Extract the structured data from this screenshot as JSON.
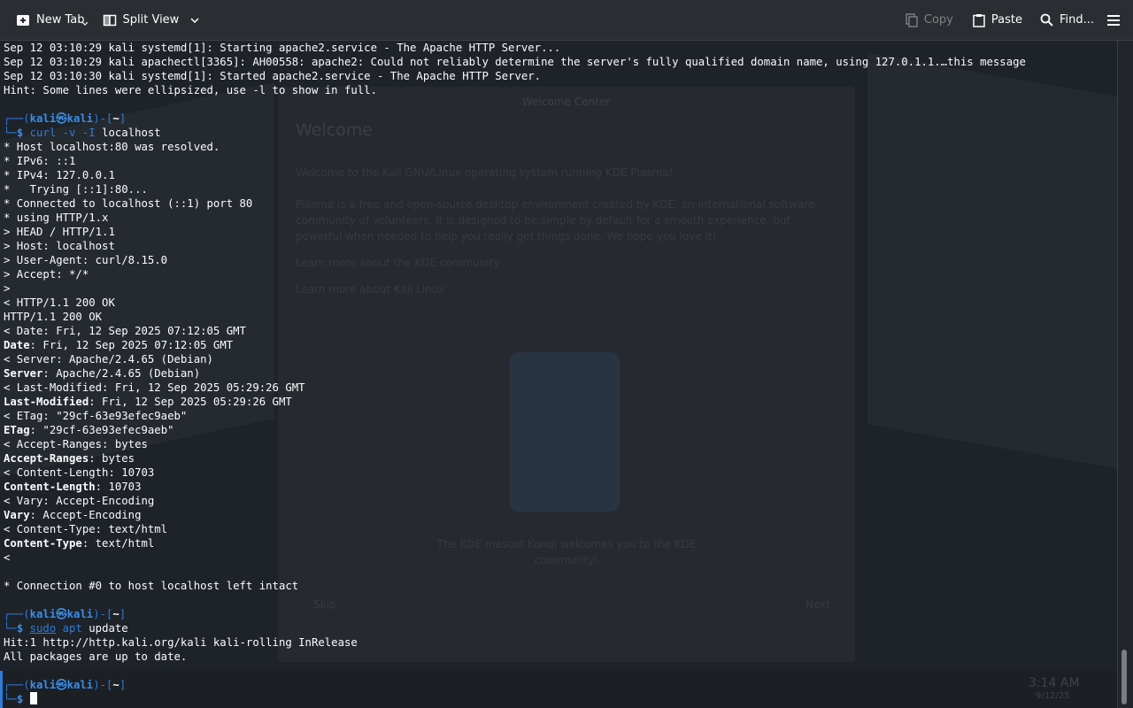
{
  "toolbar": {
    "new_tab": "New Tab",
    "split_view": "Split View",
    "copy": "Copy",
    "paste": "Paste",
    "find": "Find..."
  },
  "terminal": {
    "lines": [
      {
        "text": "Sep 12 03:10:29 kali systemd[1]: Starting apache2.service - The Apache HTTP Server..."
      },
      {
        "text": "Sep 12 03:10:29 kali apachectl[3365]: AH00558: apache2: Could not reliably determine the server's fully qualified domain name, using 127.0.1.1.…this message"
      },
      {
        "text": "Sep 12 03:10:30 kali systemd[1]: Started apache2.service - The Apache HTTP Server."
      },
      {
        "text": "Hint: Some lines were ellipsized, use -l to show in full."
      }
    ],
    "prompt1": {
      "user": "kali",
      "host": "kali",
      "dir": "~",
      "cmd": "curl",
      "args": " -v -I ",
      "target": "localhost"
    },
    "curl_output": [
      "* Host localhost:80 was resolved.",
      "* IPv6: ::1",
      "* IPv4: 127.0.0.1",
      "*   Trying [::1]:80...",
      "* Connected to localhost (::1) port 80",
      "* using HTTP/1.x",
      "> HEAD / HTTP/1.1",
      "> Host: localhost",
      "> User-Agent: curl/8.15.0",
      "> Accept: */*",
      ">",
      "< HTTP/1.1 200 OK",
      "HTTP/1.1 200 OK",
      "< Date: Fri, 12 Sep 2025 07:12:05 GMT"
    ],
    "headers": [
      {
        "key": "Date",
        "value": ": Fri, 12 Sep 2025 07:12:05 GMT"
      },
      {
        "raw": "< Server: Apache/2.4.65 (Debian)"
      },
      {
        "key": "Server",
        "value": ": Apache/2.4.65 (Debian)"
      },
      {
        "raw": "< Last-Modified: Fri, 12 Sep 2025 05:29:26 GMT"
      },
      {
        "key": "Last-Modified",
        "value": ": Fri, 12 Sep 2025 05:29:26 GMT"
      },
      {
        "raw": "< ETag: \"29cf-63e93efec9aeb\""
      },
      {
        "key": "ETag",
        "value": ": \"29cf-63e93efec9aeb\""
      },
      {
        "raw": "< Accept-Ranges: bytes"
      },
      {
        "key": "Accept-Ranges",
        "value": ": bytes"
      },
      {
        "raw": "< Content-Length: 10703"
      },
      {
        "key": "Content-Length",
        "value": ": 10703"
      },
      {
        "raw": "< Vary: Accept-Encoding"
      },
      {
        "key": "Vary",
        "value": ": Accept-Encoding"
      },
      {
        "raw": "< Content-Type: text/html"
      },
      {
        "key": "Content-Type",
        "value": ": text/html"
      },
      {
        "raw": "<"
      },
      {
        "raw": ""
      },
      {
        "raw": "* Connection #0 to host localhost left intact"
      }
    ],
    "prompt2": {
      "user": "kali",
      "host": "kali",
      "dir": "~",
      "cmd": "sudo",
      "args": " ",
      "cmd2": "apt",
      "target": " update"
    },
    "apt_output": [
      "Hit:1 http://http.kali.org/kali kali-rolling InRelease",
      "All packages are up to date."
    ],
    "prompt3": {
      "user": "kali",
      "host": "kali",
      "dir": "~"
    }
  },
  "background": {
    "panel_title": "Welcome Center",
    "welcome_heading": "Welcome",
    "welcome_text": "Welcome to the Kali GNU/Linux operating system running KDE Plasma!",
    "plasma_text": "Plasma is a free and open-source desktop environment created by KDE, an international software community of volunteers. It is designed to be simple by default for a smooth experience, but powerful when needed to help you really get things done. We hope you love it!",
    "link1": "Learn more about the KDE community",
    "link2": "Learn more about Kali Linux",
    "mascot_caption": "The KDE mascot Konqi welcomes you to the KDE community!",
    "skip": "Skip",
    "next": "Next",
    "clock_time": "3:14 AM",
    "clock_date": "9/12/25"
  },
  "colors": {
    "prompt_blue": "#2f7bd6",
    "prompt_bold_blue": "#3a8ee6",
    "terminal_bg": "#1e2229",
    "text": "#fcfcfc"
  }
}
